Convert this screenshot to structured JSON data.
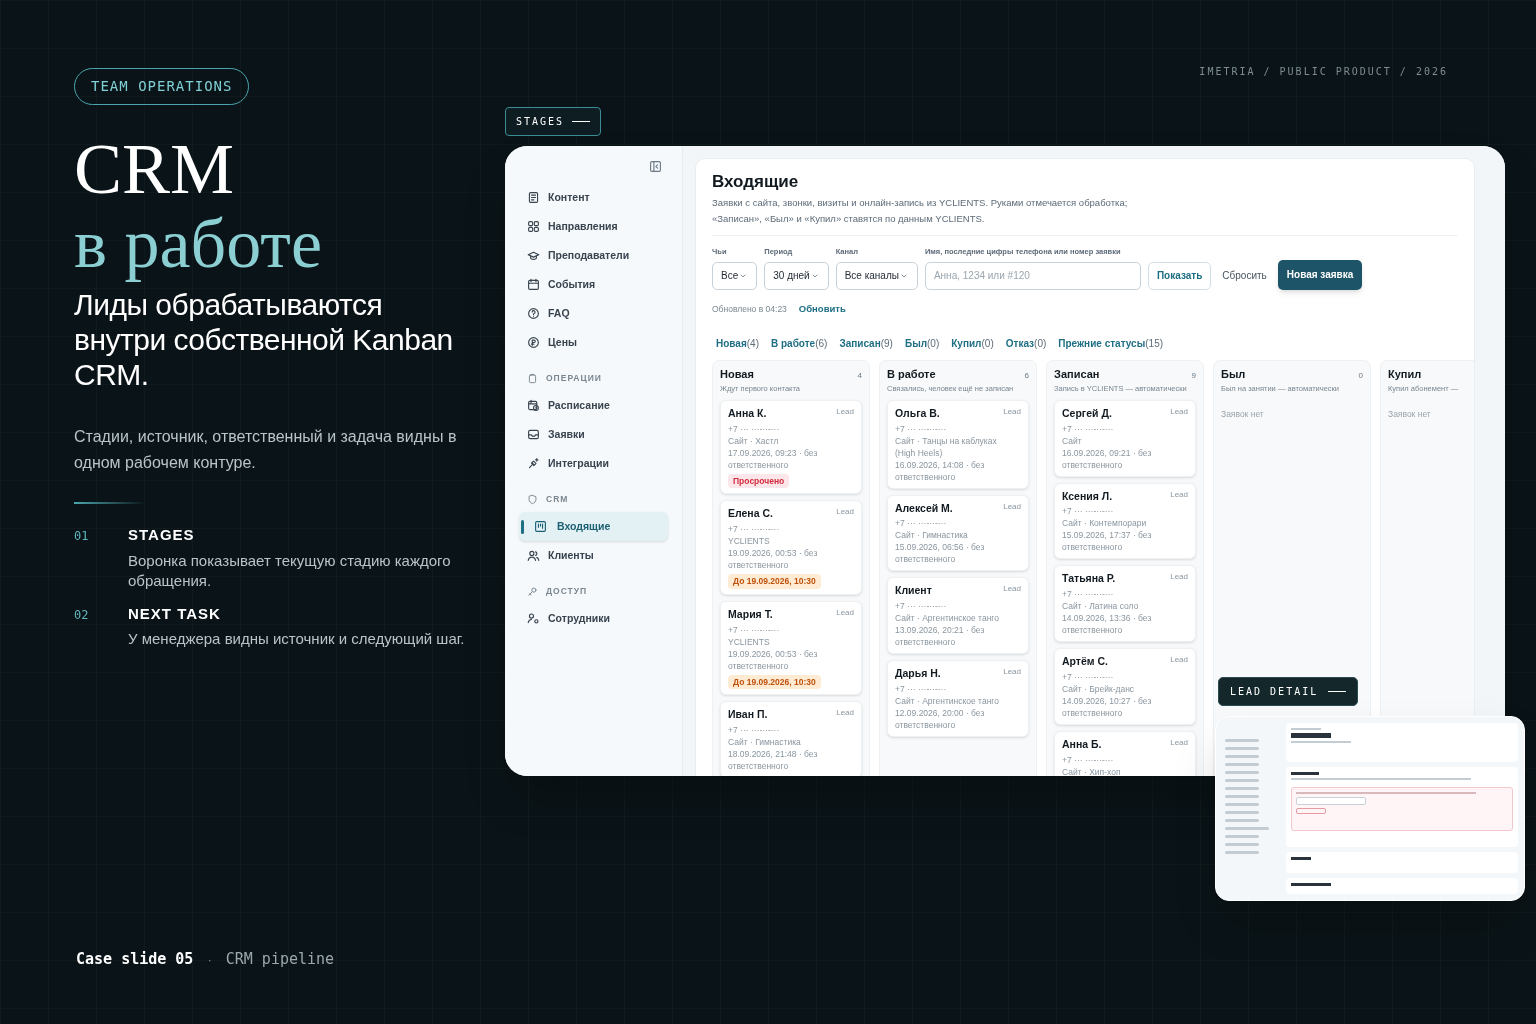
{
  "slide": {
    "tag": "TEAM OPERATIONS",
    "title_line1": "CRM",
    "title_line2": "в работе",
    "subtitle": "Лиды обрабатываются внутри собственной Kanban CRM.",
    "description": "Стадии, источник, ответственный и задача видны в одном рабочем контуре.",
    "points": [
      {
        "number": "01",
        "title": "STAGES",
        "text": "Воронка показывает текущую стадию каждого обращения."
      },
      {
        "number": "02",
        "title": "NEXT TASK",
        "text": "У менеджера видны источник и следующий шаг."
      }
    ],
    "footer": {
      "label": "Case slide 05",
      "separator": "·",
      "caption": "CRM pipeline"
    },
    "credit": "IMETRIA / PUBLIC PRODUCT / 2026",
    "stages_tag": "STAGES",
    "lead_detail_tag": "LEAD DETAIL"
  },
  "app": {
    "sidebar": {
      "items": [
        {
          "kind": "item",
          "label": "Контент",
          "selected": false
        },
        {
          "kind": "item",
          "label": "Направления",
          "selected": false
        },
        {
          "kind": "item",
          "label": "Преподаватели",
          "selected": false
        },
        {
          "kind": "item",
          "label": "События",
          "selected": false
        },
        {
          "kind": "item",
          "label": "FAQ",
          "selected": false
        },
        {
          "kind": "item",
          "label": "Цены",
          "selected": false
        },
        {
          "kind": "section",
          "label": "ОПЕРАЦИИ"
        },
        {
          "kind": "item",
          "label": "Расписание",
          "selected": false
        },
        {
          "kind": "item",
          "label": "Заявки",
          "selected": false
        },
        {
          "kind": "item",
          "label": "Интеграции",
          "selected": false
        },
        {
          "kind": "section",
          "label": "CRM"
        },
        {
          "kind": "item",
          "label": "Входящие",
          "selected": true
        },
        {
          "kind": "item",
          "label": "Клиенты",
          "selected": false
        },
        {
          "kind": "section",
          "label": "ДОСТУП"
        },
        {
          "kind": "item",
          "label": "Сотрудники",
          "selected": false
        }
      ]
    },
    "heading": "Входящие",
    "description": [
      "Заявки с сайта, звонки, визиты и онлайн-запись из YCLIENTS. Руками отмечается обработка;",
      "«Записан», «Был» и «Купил» ставятся по данным YCLIENTS."
    ],
    "filters": [
      {
        "label": "Чьи",
        "value": "Все"
      },
      {
        "label": "Период",
        "value": "30 дней"
      },
      {
        "label": "Канал",
        "value": "Все каналы"
      }
    ],
    "search": {
      "label": "Имя, последние цифры телефона или номер заявки",
      "placeholder": "Анна, 1234 или #120"
    },
    "show_button": "Показать",
    "reset_button": "Сбросить",
    "new_button": "Новая заявка",
    "updated": "Обновлено в 04:23",
    "refresh": "Обновить",
    "stage_tabs": [
      {
        "label": "Новая",
        "count": "(4)"
      },
      {
        "label": "В работе",
        "count": "(6)"
      },
      {
        "label": "Записан",
        "count": "(9)"
      },
      {
        "label": "Был",
        "count": "(0)"
      },
      {
        "label": "Купил",
        "count": "(0)"
      },
      {
        "label": "Отказ",
        "count": "(0)"
      },
      {
        "label": "Прежние статусы",
        "count": "(15)"
      }
    ],
    "columns": [
      {
        "title": "Новая",
        "count": "4",
        "subtitle": "Ждут первого контакта",
        "cards": [
          {
            "name": "Анна К.",
            "tag": "Lead",
            "phone": "+7 ··· ···-··-···",
            "source": "Сайт · Хастл",
            "meta": "17.09.2026, 09:23 · без ответственного",
            "badge": {
              "kind": "overdue",
              "text": "Просрочено"
            }
          },
          {
            "name": "Елена С.",
            "tag": "Lead",
            "phone": "+7 ··· ···-··-···",
            "source": "YCLIENTS",
            "meta": "19.09.2026, 00:53 · без ответственного",
            "badge": {
              "kind": "deadline",
              "text": "До 19.09.2026, 10:30"
            }
          },
          {
            "name": "Мария Т.",
            "tag": "Lead",
            "phone": "+7 ··· ···-··-···",
            "source": "YCLIENTS",
            "meta": "19.09.2026, 00:53 · без ответственного",
            "badge": {
              "kind": "deadline",
              "text": "До 19.09.2026, 10:30"
            }
          },
          {
            "name": "Иван П.",
            "tag": "Lead",
            "phone": "+7 ··· ···-··-···",
            "source": "Сайт · Гимнастика",
            "meta": "18.09.2026, 21:48 · без ответственного"
          }
        ]
      },
      {
        "title": "В работе",
        "count": "6",
        "subtitle": "Связались, человек ещё не записан",
        "cards": [
          {
            "name": "Ольга В.",
            "tag": "Lead",
            "phone": "+7 ··· ···-··-···",
            "source": "Сайт · Танцы на каблуках (High Heels)",
            "meta": "16.09.2026, 14:08 · без ответственного"
          },
          {
            "name": "Алексей М.",
            "tag": "Lead",
            "phone": "+7 ··· ···-··-···",
            "source": "Сайт · Гимнастика",
            "meta": "15.09.2026, 06:56 · без ответственного"
          },
          {
            "name": "Клиент",
            "tag": "Lead",
            "phone": "+7 ··· ···-··-···",
            "source": "Сайт · Аргентинское танго",
            "meta": "13.09.2026, 20:21 · без ответственного"
          },
          {
            "name": "Дарья Н.",
            "tag": "Lead",
            "phone": "+7 ··· ···-··-···",
            "source": "Сайт · Аргентинское танго",
            "meta": "12.09.2026, 20:00 · без ответственного"
          }
        ]
      },
      {
        "title": "Записан",
        "count": "9",
        "subtitle": "Запись в YCLIENTS — автоматически",
        "cards": [
          {
            "name": "Сергей Д.",
            "tag": "Lead",
            "phone": "+7 ··· ···-··-···",
            "source": "Сайт",
            "meta": "16.09.2026, 09:21 · без ответственного"
          },
          {
            "name": "Ксения Л.",
            "tag": "Lead",
            "phone": "+7 ··· ···-··-···",
            "source": "Сайт · Контемпорари",
            "meta": "15.09.2026, 17:37 · без ответственного"
          },
          {
            "name": "Татьяна Р.",
            "tag": "Lead",
            "phone": "+7 ··· ···-··-···",
            "source": "Сайт · Латина соло",
            "meta": "14.09.2026, 13:36 · без ответственного"
          },
          {
            "name": "Артём С.",
            "tag": "Lead",
            "phone": "+7 ··· ···-··-···",
            "source": "Сайт · Брейк-данс",
            "meta": "14.09.2026, 10:27 · без ответственного"
          },
          {
            "name": "Анна Б.",
            "tag": "Lead",
            "phone": "+7 ··· ···-··-···",
            "source": "Сайт · Хип-хоп"
          }
        ]
      },
      {
        "title": "Был",
        "count": "0",
        "subtitle": "Был на занятии — автоматически",
        "empty": "Заявок нет"
      },
      {
        "title": "Купил",
        "subtitle": "Купил абонемент —",
        "empty": "Заявок нет"
      }
    ]
  }
}
